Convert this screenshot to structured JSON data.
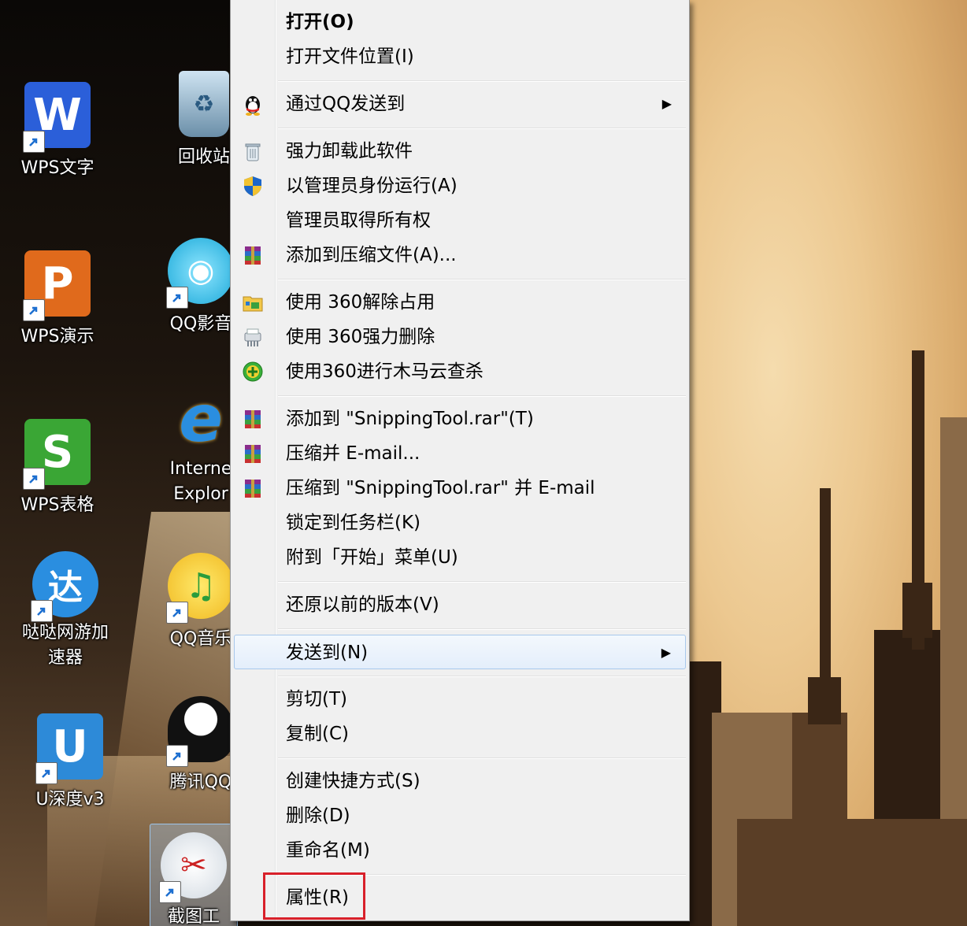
{
  "desktop": {
    "icons": [
      {
        "label": "WPS文字",
        "glyph": "W",
        "color": "#2b5fd9",
        "icon": "wps-writer-icon"
      },
      {
        "label": "WPS演示",
        "glyph": "P",
        "color": "#e06a1c",
        "icon": "wps-presentation-icon"
      },
      {
        "label": "WPS表格",
        "glyph": "S",
        "color": "#3aa635",
        "icon": "wps-spreadsheet-icon"
      },
      {
        "label": "哒哒网游加",
        "label2": "速器",
        "glyph": "达",
        "color": "#2a8ee0",
        "icon": "dada-accelerator-icon"
      },
      {
        "label": "U深度v3",
        "glyph": "U",
        "color": "#2d8ad8",
        "icon": "usb-udepth-icon"
      },
      {
        "label": "回收站",
        "icon": "recycle-bin-icon"
      },
      {
        "label": "QQ影音",
        "icon": "qq-player-icon"
      },
      {
        "label": "Interne",
        "label2": "Explor",
        "icon": "internet-explorer-icon"
      },
      {
        "label": "QQ音乐",
        "icon": "qq-music-icon"
      },
      {
        "label": "腾讯QQ",
        "icon": "tencent-qq-icon"
      },
      {
        "label": "截图工",
        "icon": "snipping-tool-icon"
      }
    ]
  },
  "menu": {
    "items": [
      {
        "label": "打开(O)",
        "bold": true
      },
      {
        "label": "打开文件位置(I)"
      },
      {
        "label": "通过QQ发送到",
        "icon": "qq-penguin-icon",
        "submenu": true
      },
      {
        "label": "强力卸载此软件",
        "icon": "trash-can-icon"
      },
      {
        "label": "以管理员身份运行(A)",
        "icon": "uac-shield-icon"
      },
      {
        "label": "管理员取得所有权"
      },
      {
        "label": "添加到压缩文件(A)...",
        "icon": "winrar-icon"
      },
      {
        "label": "使用 360解除占用",
        "icon": "folder-unlock-icon"
      },
      {
        "label": "使用 360强力删除",
        "icon": "shredder-icon"
      },
      {
        "label": "使用360进行木马云查杀",
        "icon": "360-scan-icon"
      },
      {
        "label": "添加到 \"SnippingTool.rar\"(T)",
        "icon": "winrar-icon"
      },
      {
        "label": "压缩并 E-mail...",
        "icon": "winrar-icon"
      },
      {
        "label": "压缩到 \"SnippingTool.rar\" 并 E-mail",
        "icon": "winrar-icon"
      },
      {
        "label": "锁定到任务栏(K)"
      },
      {
        "label": "附到「开始」菜单(U)"
      },
      {
        "label": "还原以前的版本(V)"
      },
      {
        "label": "发送到(N)",
        "submenu": true,
        "hover": true
      },
      {
        "label": "剪切(T)"
      },
      {
        "label": "复制(C)"
      },
      {
        "label": "创建快捷方式(S)"
      },
      {
        "label": "删除(D)"
      },
      {
        "label": "重命名(M)"
      },
      {
        "label": "属性(R)",
        "highlighted": true
      }
    ],
    "submenu_arrow": "▶",
    "highlight_color": "#d8202a",
    "hover_color": "#e4eefb"
  }
}
